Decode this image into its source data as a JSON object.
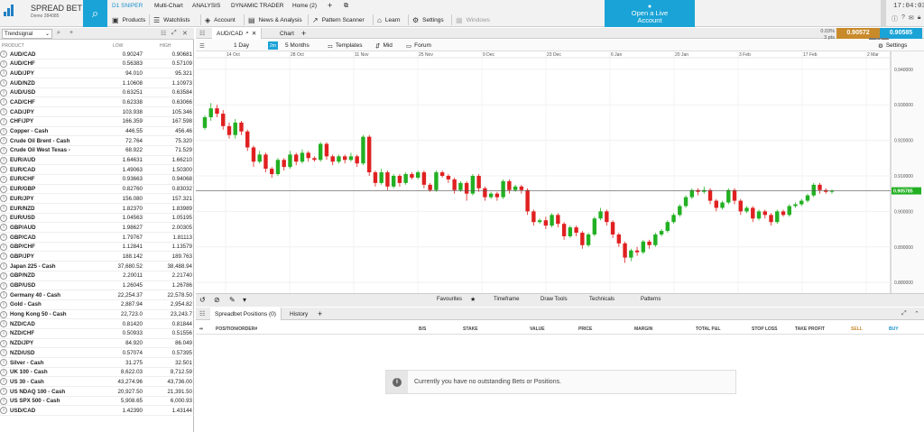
{
  "brand": {
    "name": "SPREAD BET",
    "account": "Demo 284085"
  },
  "top_tabs": [
    {
      "label": "D1 SNIPER",
      "active": true
    },
    {
      "label": "Multi-Chart"
    },
    {
      "label": "ANALYSIS"
    },
    {
      "label": "DYNAMIC TRADER"
    },
    {
      "label": "Home (2)"
    }
  ],
  "menu": [
    {
      "label": "Products",
      "icon": "cube-icon"
    },
    {
      "label": "Watchlists",
      "icon": "list-icon"
    },
    {
      "label": "Account",
      "icon": "tag-icon"
    },
    {
      "label": "News & Analysis",
      "icon": "news-icon"
    },
    {
      "label": "Pattern Scanner",
      "icon": "chart-icon"
    },
    {
      "label": "Learn",
      "icon": "graduation-icon"
    },
    {
      "label": "Settings",
      "icon": "gear-icon"
    },
    {
      "label": "Windows",
      "icon": "windows-icon",
      "disabled": true
    }
  ],
  "live_account": {
    "line1": "Open a Live",
    "line2": "Account"
  },
  "clock": "17:04:03",
  "watchlist": {
    "selector": "Trendsignal",
    "columns": {
      "product": "PRODUCT",
      "low": "LOW",
      "high": "HIGH"
    },
    "rows": [
      {
        "name": "AUD/CAD",
        "low": "0.90247",
        "high": "0.90681"
      },
      {
        "name": "AUD/CHF",
        "low": "0.56383",
        "high": "0.57109"
      },
      {
        "name": "AUD/JPY",
        "low": "94.010",
        "high": "95.321"
      },
      {
        "name": "AUD/NZD",
        "low": "1.10608",
        "high": "1.10973"
      },
      {
        "name": "AUD/USD",
        "low": "0.63251",
        "high": "0.63584"
      },
      {
        "name": "CAD/CHF",
        "low": "0.62338",
        "high": "0.63066"
      },
      {
        "name": "CAD/JPY",
        "low": "103.938",
        "high": "105.346"
      },
      {
        "name": "CHF/JPY",
        "low": "166.359",
        "high": "167.598"
      },
      {
        "name": "Copper - Cash",
        "low": "446.55",
        "high": "456.46"
      },
      {
        "name": "Crude Oil Brent - Cash",
        "low": "72.764",
        "high": "75.320"
      },
      {
        "name": "Crude Oil West Texas -",
        "low": "68.922",
        "high": "71.529"
      },
      {
        "name": "EUR/AUD",
        "low": "1.64631",
        "high": "1.66210"
      },
      {
        "name": "EUR/CAD",
        "low": "1.49063",
        "high": "1.50300"
      },
      {
        "name": "EUR/CHF",
        "low": "0.93663",
        "high": "0.94068"
      },
      {
        "name": "EUR/GBP",
        "low": "0.82760",
        "high": "0.83032"
      },
      {
        "name": "EUR/JPY",
        "low": "156.080",
        "high": "157.321"
      },
      {
        "name": "EUR/NZD",
        "low": "1.82370",
        "high": "1.83989"
      },
      {
        "name": "EUR/USD",
        "low": "1.04563",
        "high": "1.05195"
      },
      {
        "name": "GBP/AUD",
        "low": "1.98627",
        "high": "2.00305"
      },
      {
        "name": "GBP/CAD",
        "low": "1.79767",
        "high": "1.81113"
      },
      {
        "name": "GBP/CHF",
        "low": "1.12841",
        "high": "1.13579"
      },
      {
        "name": "GBP/JPY",
        "low": "188.142",
        "high": "189.763"
      },
      {
        "name": "Japan 225 - Cash",
        "low": "37,680.52",
        "high": "38,488.94"
      },
      {
        "name": "GBP/NZD",
        "low": "2.20011",
        "high": "2.21740"
      },
      {
        "name": "GBP/USD",
        "low": "1.26045",
        "high": "1.26786"
      },
      {
        "name": "Germany 40 - Cash",
        "low": "22,254.37",
        "high": "22,578.50"
      },
      {
        "name": "Gold - Cash",
        "low": "2,887.94",
        "high": "2,954.82"
      },
      {
        "name": "Hong Kong 50 - Cash",
        "low": "22,723.0",
        "high": "23,243.7"
      },
      {
        "name": "NZD/CAD",
        "low": "0.81420",
        "high": "0.81844"
      },
      {
        "name": "NZD/CHF",
        "low": "0.50933",
        "high": "0.51556"
      },
      {
        "name": "NZD/JPY",
        "low": "84.920",
        "high": "86.049"
      },
      {
        "name": "NZD/USD",
        "low": "0.57074",
        "high": "0.57395"
      },
      {
        "name": "Silver - Cash",
        "low": "31.275",
        "high": "32.501"
      },
      {
        "name": "UK 100 - Cash",
        "low": "8,622.03",
        "high": "8,712.59"
      },
      {
        "name": "US 30 - Cash",
        "low": "43,274.96",
        "high": "43,736.00"
      },
      {
        "name": "US NDAQ 100 - Cash",
        "low": "20,927.50",
        "high": "21,391.50"
      },
      {
        "name": "US SPX 500 - Cash",
        "low": "5,908.65",
        "high": "6,000.93"
      },
      {
        "name": "USD/CAD",
        "low": "1.42390",
        "high": "1.43144"
      }
    ]
  },
  "chart": {
    "tab": "AUD/CAD",
    "tab2": "Chart",
    "interval": "1 Day",
    "interval_badge": "2m",
    "range": "5 Months",
    "templates": "Templates",
    "mid": "Mid",
    "forum": "Forum",
    "settings": "Settings",
    "quote": {
      "change": "0.03%",
      "pts": "3 pts",
      "sell": "0.90572",
      "buy": "0.90585",
      "spread": "1.3"
    },
    "bottom_tabs": [
      "Favourites",
      "Timeframe",
      "Draw Tools",
      "Technicals",
      "Patterns"
    ]
  },
  "chart_data": {
    "type": "candlestick",
    "x_ticks": [
      "14 Oct",
      "28 Oct",
      "11 Nov",
      "25 Nov",
      "9 Dec",
      "23 Dec",
      "6 Jan",
      "20 Jan",
      "3 Feb",
      "17 Feb",
      "2 Mar"
    ],
    "y_ticks": [
      "0.940000",
      "0.930000",
      "0.920000",
      "0.910000",
      "0.900000",
      "0.890000",
      "0.880000"
    ],
    "ylim": [
      0.877,
      0.943
    ],
    "current_price": "0.905785",
    "colors": {
      "up": "#22b022",
      "down": "#e02020"
    },
    "candles": [
      [
        0.9235,
        0.9265,
        0.923,
        0.927
      ],
      [
        0.9265,
        0.929,
        0.9255,
        0.9305
      ],
      [
        0.929,
        0.9275,
        0.9265,
        0.93
      ],
      [
        0.9275,
        0.924,
        0.923,
        0.9285
      ],
      [
        0.924,
        0.9215,
        0.9205,
        0.925
      ],
      [
        0.9215,
        0.925,
        0.9205,
        0.926
      ],
      [
        0.925,
        0.9225,
        0.9215,
        0.9255
      ],
      [
        0.9225,
        0.918,
        0.917,
        0.923
      ],
      [
        0.918,
        0.914,
        0.9125,
        0.9185
      ],
      [
        0.914,
        0.916,
        0.9135,
        0.917
      ],
      [
        0.916,
        0.912,
        0.911,
        0.9165
      ],
      [
        0.912,
        0.9105,
        0.9095,
        0.9125
      ],
      [
        0.9105,
        0.9145,
        0.91,
        0.915
      ],
      [
        0.9145,
        0.9125,
        0.9115,
        0.915
      ],
      [
        0.9125,
        0.916,
        0.912,
        0.917
      ],
      [
        0.916,
        0.914,
        0.913,
        0.9165
      ],
      [
        0.914,
        0.9165,
        0.9135,
        0.9175
      ],
      [
        0.9165,
        0.915,
        0.914,
        0.917
      ],
      [
        0.915,
        0.9145,
        0.914,
        0.9155
      ],
      [
        0.9145,
        0.919,
        0.914,
        0.9195
      ],
      [
        0.919,
        0.9155,
        0.9145,
        0.9195
      ],
      [
        0.9155,
        0.914,
        0.913,
        0.916
      ],
      [
        0.914,
        0.9155,
        0.9135,
        0.916
      ],
      [
        0.9155,
        0.9145,
        0.9135,
        0.916
      ],
      [
        0.9145,
        0.9155,
        0.914,
        0.9165
      ],
      [
        0.9155,
        0.9135,
        0.9125,
        0.916
      ],
      [
        0.9135,
        0.921,
        0.913,
        0.9215
      ],
      [
        0.921,
        0.911,
        0.91,
        0.9215
      ],
      [
        0.911,
        0.908,
        0.907,
        0.9115
      ],
      [
        0.908,
        0.911,
        0.9075,
        0.912
      ],
      [
        0.911,
        0.907,
        0.906,
        0.9115
      ],
      [
        0.907,
        0.91,
        0.9065,
        0.9105
      ],
      [
        0.91,
        0.908,
        0.907,
        0.9105
      ],
      [
        0.908,
        0.9105,
        0.9075,
        0.911
      ],
      [
        0.9105,
        0.9095,
        0.909,
        0.911
      ],
      [
        0.9095,
        0.911,
        0.909,
        0.9115
      ],
      [
        0.911,
        0.9075,
        0.9065,
        0.9115
      ],
      [
        0.9075,
        0.906,
        0.9055,
        0.908
      ],
      [
        0.906,
        0.911,
        0.9055,
        0.9115
      ],
      [
        0.911,
        0.91,
        0.9095,
        0.9115
      ],
      [
        0.91,
        0.909,
        0.908,
        0.9105
      ],
      [
        0.909,
        0.906,
        0.905,
        0.9095
      ],
      [
        0.906,
        0.908,
        0.9055,
        0.9085
      ],
      [
        0.908,
        0.905,
        0.903,
        0.9085
      ],
      [
        0.905,
        0.91,
        0.9045,
        0.9105
      ],
      [
        0.91,
        0.9065,
        0.9055,
        0.9105
      ],
      [
        0.9065,
        0.904,
        0.903,
        0.907
      ],
      [
        0.904,
        0.905,
        0.9035,
        0.9055
      ],
      [
        0.905,
        0.904,
        0.903,
        0.9055
      ],
      [
        0.904,
        0.9085,
        0.9035,
        0.909
      ],
      [
        0.9085,
        0.906,
        0.905,
        0.909
      ],
      [
        0.906,
        0.907,
        0.9055,
        0.9075
      ],
      [
        0.907,
        0.906,
        0.905,
        0.9075
      ],
      [
        0.906,
        0.9,
        0.899,
        0.9065
      ],
      [
        0.9,
        0.897,
        0.896,
        0.9005
      ],
      [
        0.897,
        0.8975,
        0.8965,
        0.898
      ],
      [
        0.8975,
        0.896,
        0.895,
        0.8985
      ],
      [
        0.896,
        0.899,
        0.8955,
        0.8995
      ],
      [
        0.899,
        0.8965,
        0.8955,
        0.8995
      ],
      [
        0.8965,
        0.893,
        0.892,
        0.897
      ],
      [
        0.893,
        0.8955,
        0.8925,
        0.896
      ],
      [
        0.8955,
        0.894,
        0.893,
        0.896
      ],
      [
        0.894,
        0.8905,
        0.8895,
        0.8945
      ],
      [
        0.8905,
        0.8935,
        0.89,
        0.894
      ],
      [
        0.8935,
        0.898,
        0.893,
        0.8985
      ],
      [
        0.898,
        0.9,
        0.8975,
        0.901
      ],
      [
        0.9,
        0.897,
        0.896,
        0.9005
      ],
      [
        0.897,
        0.8935,
        0.8925,
        0.8975
      ],
      [
        0.8935,
        0.891,
        0.89,
        0.894
      ],
      [
        0.891,
        0.887,
        0.8855,
        0.8915
      ],
      [
        0.887,
        0.889,
        0.886,
        0.8895
      ],
      [
        0.889,
        0.8885,
        0.8875,
        0.89
      ],
      [
        0.8885,
        0.8915,
        0.888,
        0.892
      ],
      [
        0.8915,
        0.8905,
        0.8895,
        0.892
      ],
      [
        0.8905,
        0.8935,
        0.89,
        0.894
      ],
      [
        0.8935,
        0.8945,
        0.893,
        0.895
      ],
      [
        0.8945,
        0.897,
        0.894,
        0.8975
      ],
      [
        0.897,
        0.899,
        0.8965,
        0.8995
      ],
      [
        0.899,
        0.9015,
        0.8985,
        0.902
      ],
      [
        0.9015,
        0.904,
        0.901,
        0.9045
      ],
      [
        0.904,
        0.906,
        0.9035,
        0.9065
      ],
      [
        0.906,
        0.9055,
        0.9045,
        0.9065
      ],
      [
        0.9055,
        0.906,
        0.905,
        0.907
      ],
      [
        0.906,
        0.903,
        0.902,
        0.9065
      ],
      [
        0.903,
        0.901,
        0.9,
        0.9035
      ],
      [
        0.901,
        0.9025,
        0.9005,
        0.903
      ],
      [
        0.9025,
        0.906,
        0.902,
        0.9065
      ],
      [
        0.906,
        0.903,
        0.902,
        0.9065
      ],
      [
        0.903,
        0.9,
        0.899,
        0.9035
      ],
      [
        0.9,
        0.901,
        0.8995,
        0.9015
      ],
      [
        0.901,
        0.898,
        0.897,
        0.9015
      ],
      [
        0.898,
        0.9,
        0.8975,
        0.9005
      ],
      [
        0.9,
        0.899,
        0.898,
        0.9005
      ],
      [
        0.899,
        0.897,
        0.896,
        0.8995
      ],
      [
        0.897,
        0.9,
        0.8965,
        0.9005
      ],
      [
        0.9,
        0.899,
        0.8985,
        0.9005
      ],
      [
        0.899,
        0.9015,
        0.8985,
        0.902
      ],
      [
        0.9015,
        0.902,
        0.901,
        0.9025
      ],
      [
        0.902,
        0.903,
        0.9015,
        0.9035
      ],
      [
        0.903,
        0.9045,
        0.9025,
        0.905
      ],
      [
        0.9045,
        0.9075,
        0.904,
        0.908
      ],
      [
        0.9075,
        0.906,
        0.905,
        0.908
      ],
      [
        0.906,
        0.9055,
        0.905,
        0.9065
      ],
      [
        0.9055,
        0.9058,
        0.905,
        0.9062
      ]
    ]
  },
  "positions": {
    "tab": "Spreadbet Positions (0)",
    "tab2": "History",
    "columns": [
      "POSITION/ORDER#",
      "B/S",
      "STAKE",
      "VALUE",
      "PRICE",
      "MARGIN",
      "TOTAL P&L",
      "STOP LOSS",
      "TAKE PROFIT",
      "SELL",
      "BUY"
    ],
    "empty_message": "Currently you have no outstanding Bets or Positions."
  }
}
